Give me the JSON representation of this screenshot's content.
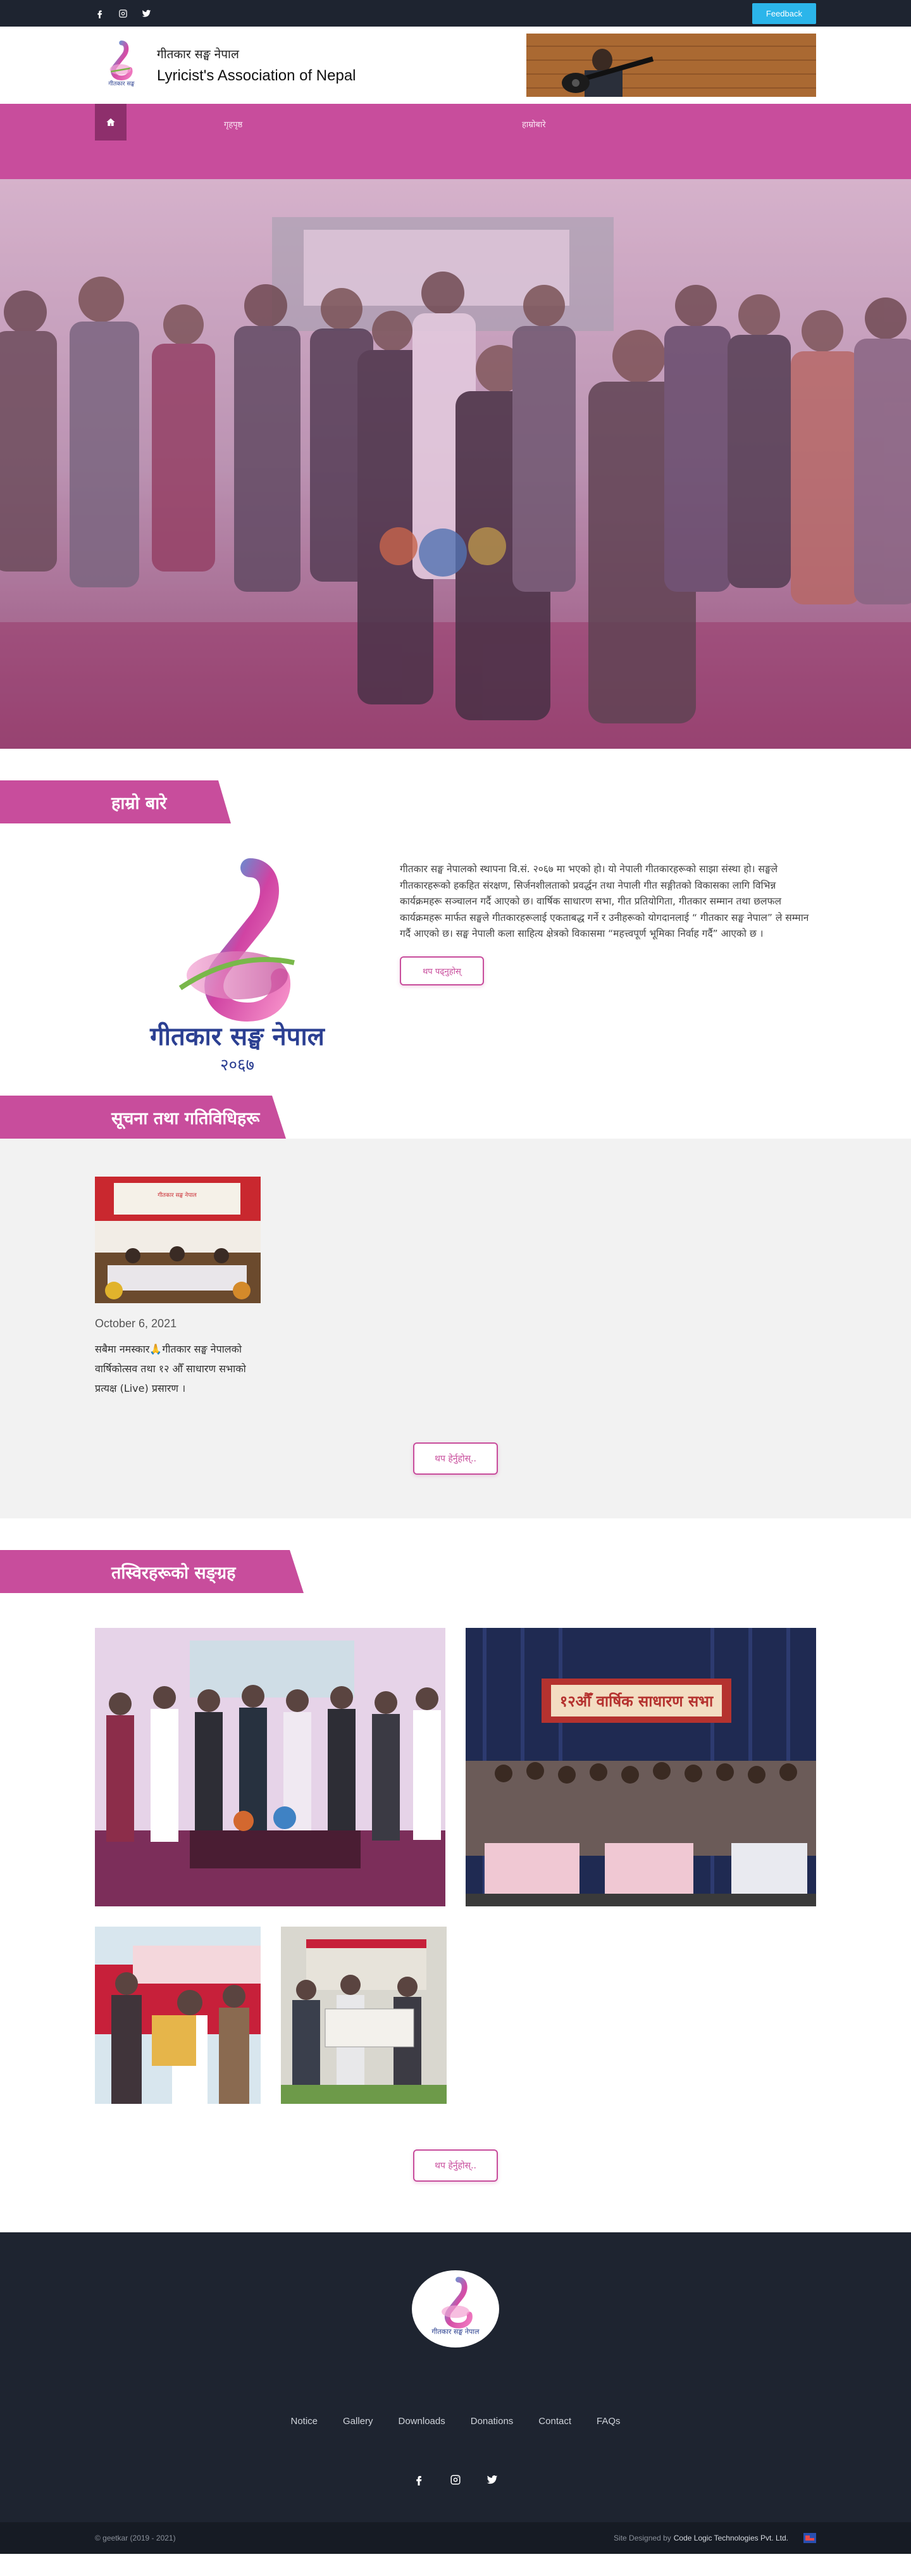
{
  "topbar": {
    "icons": [
      "facebook-icon",
      "instagram-icon",
      "twitter-icon"
    ],
    "feedback_label": "Feedback"
  },
  "brand": {
    "name_np": "गीतकार सङ्घ नेपाल",
    "name_en": "Lyricist's Association of Nepal",
    "logo_caption": "गीतकार सङ्घ नेपाल",
    "logo_year": "२०६७"
  },
  "nav": {
    "items": [
      "गृहपृष्ठ",
      "हाम्रोबारे"
    ]
  },
  "about": {
    "heading": "हाम्रो बारे",
    "body": "गीतकार सङ्घ नेपालको स्थापना वि.सं. २०६७ मा भएको हो। यो नेपाली गीतकारहरूको साझा संस्था हो। सङ्घले गीतकारहरूको हकहित संरक्षण, सिर्जनशीलताको प्रवर्द्धन तथा नेपाली गीत सङ्गीतको विकासका लागि विभिन्न कार्यक्रमहरू सञ्चालन गर्दै आएको छ। वार्षिक साधारण सभा, गीत प्रतियोगिता, गीतकार सम्मान तथा छलफल कार्यक्रमहरू मार्फत सङ्घले गीतकारहरूलाई एकताबद्ध गर्ने र उनीहरूको योगदानलाई “ गीतकार सङ्घ नेपाल” ले सम्मान गर्दै आएको छ। सङ्घ नेपाली कला साहित्य क्षेत्रको विकासमा “महत्त्वपूर्ण भूमिका निर्वाह गर्दै” आएको छ ।",
    "read_more": "थप पढ्नुहोस्"
  },
  "news": {
    "heading": "सूचना तथा गतिविधिहरू",
    "items": [
      {
        "date": "October 6, 2021",
        "title": "सबैमा नमस्कार🙏गीतकार सङ्घ नेपालको वार्षिकोत्सव तथा १२ औँ साधारण सभाको प्रत्यक्ष (Live) प्रसारण ।"
      }
    ],
    "more": "थप हेर्नुहोस्.."
  },
  "gallery": {
    "heading": "तस्विरहरूको सङ्ग्रह",
    "banner_text": "१२औँ वार्षिक साधारण सभा",
    "more": "थप हेर्नुहोस्.."
  },
  "footer": {
    "links": [
      "Notice",
      "Gallery",
      "Downloads",
      "Donations",
      "Contact",
      "FAQs"
    ],
    "icons": [
      "facebook-icon",
      "instagram-icon",
      "twitter-icon"
    ],
    "copyright": "© geetkar (2019 - 2021)",
    "designed_by_prefix": "Site Designed by",
    "designed_by_company": "Code Logic Technologies Pvt. Ltd."
  },
  "colors": {
    "brand_pink": "#c84d9c",
    "dark": "#1e2430",
    "feedback_blue": "#2bb5ea"
  }
}
